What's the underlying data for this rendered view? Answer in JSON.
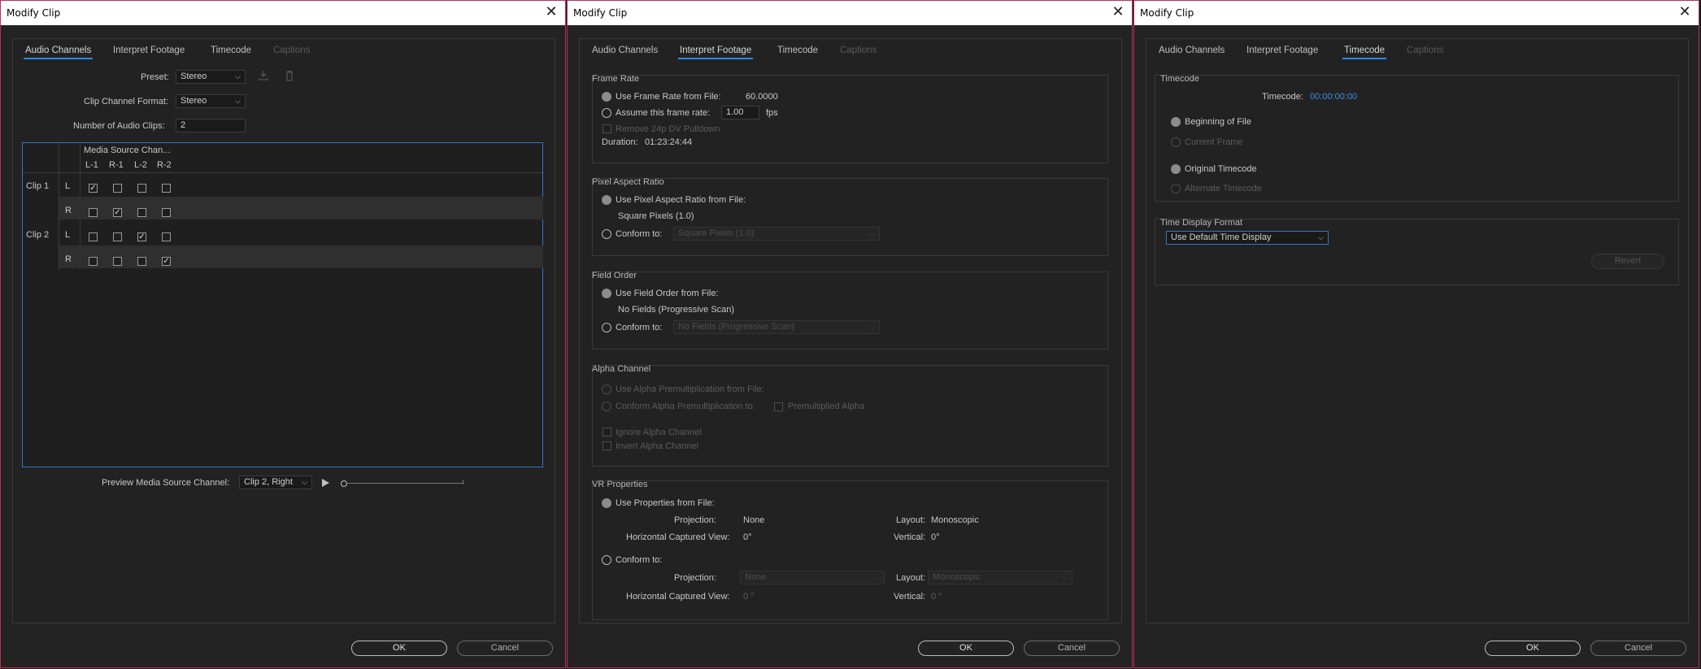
{
  "windows": [
    {
      "title": "Modify Clip",
      "close": "✕",
      "tabs": [
        "Audio Channels",
        "Interpret Footage",
        "Timecode",
        "Captions"
      ],
      "active_tab": "Audio Channels",
      "preset_label": "Preset:",
      "preset_value": "Stereo",
      "clip_channel_format_label": "Clip Channel Format:",
      "clip_channel_format_value": "Stereo",
      "number_of_audio_clips_label": "Number of Audio Clips:",
      "number_of_audio_clips_value": "2",
      "media_source_header": "Media Source Chan...",
      "source_columns": [
        "L-1",
        "R-1",
        "L-2",
        "R-2"
      ],
      "rows": [
        {
          "clip": "Clip 1",
          "channel": "L",
          "checks": [
            true,
            false,
            false,
            false
          ]
        },
        {
          "clip": "",
          "channel": "R",
          "checks": [
            false,
            true,
            false,
            false
          ]
        },
        {
          "clip": "Clip 2",
          "channel": "L",
          "checks": [
            false,
            false,
            true,
            false
          ]
        },
        {
          "clip": "",
          "channel": "R",
          "checks": [
            false,
            false,
            false,
            true
          ]
        }
      ],
      "preview_label": "Preview Media Source Channel:",
      "preview_value": "Clip 2, Right",
      "ok": "OK",
      "cancel": "Cancel"
    },
    {
      "title": "Modify Clip",
      "close": "✕",
      "tabs": [
        "Audio Channels",
        "Interpret Footage",
        "Timecode",
        "Captions"
      ],
      "active_tab": "Interpret Footage",
      "frame_rate": {
        "title": "Frame Rate",
        "use_from_file": "Use Frame Rate from File:",
        "file_rate": "60.0000",
        "assume": "Assume this frame rate:",
        "assume_value": "1.00",
        "fps": "fps",
        "remove_pulldown": "Remove 24p DV Pulldown",
        "duration_label": "Duration:",
        "duration_value": "01:23:24:44"
      },
      "pixel_aspect": {
        "title": "Pixel Aspect Ratio",
        "use_from_file": "Use Pixel Aspect Ratio from File:",
        "file_value": "Square Pixels (1.0)",
        "conform": "Conform to:",
        "conform_value": "Square Pixels (1.0)"
      },
      "field_order": {
        "title": "Field Order",
        "use_from_file": "Use Field Order from File:",
        "file_value": "No Fields (Progressive Scan)",
        "conform": "Conform to:",
        "conform_value": "No Fields (Progressive Scan)"
      },
      "alpha": {
        "title": "Alpha Channel",
        "use_premult": "Use Alpha Premultiplication from File:",
        "conform_premult": "Conform Alpha Premultiplication to:",
        "premultiplied": "Premultiplied Alpha",
        "ignore": "Ignore Alpha Channel",
        "invert": "Invert Alpha Channel"
      },
      "vr": {
        "title": "VR Properties",
        "use_from_file": "Use Properties from File:",
        "projection_label": "Projection:",
        "projection_value": "None",
        "layout_label": "Layout:",
        "layout_value": "Monoscopic",
        "hcv_label": "Horizontal Captured View:",
        "hcv_value": "0°",
        "vertical_label": "Vertical:",
        "vertical_value": "0°",
        "conform": "Conform to:",
        "conform_projection": "None",
        "conform_layout": "Monoscopic",
        "conform_hcv": "0 °",
        "conform_vertical": "0 °"
      },
      "ok": "OK",
      "cancel": "Cancel"
    },
    {
      "title": "Modify Clip",
      "close": "✕",
      "tabs": [
        "Audio Channels",
        "Interpret Footage",
        "Timecode",
        "Captions"
      ],
      "active_tab": "Timecode",
      "timecode": {
        "title": "Timecode",
        "label": "Timecode:",
        "value": "00:00:00:00",
        "beginning": "Beginning of File",
        "current": "Current Frame",
        "original": "Original Timecode",
        "alternate": "Alternate Timecode"
      },
      "display": {
        "title": "Time Display Format",
        "value": "Use Default Time Display",
        "revert": "Revert"
      },
      "ok": "OK",
      "cancel": "Cancel"
    }
  ],
  "colors": {
    "accent": "#2d8ceb",
    "border": "#b5305a",
    "timecode": "#3d8fe0"
  }
}
